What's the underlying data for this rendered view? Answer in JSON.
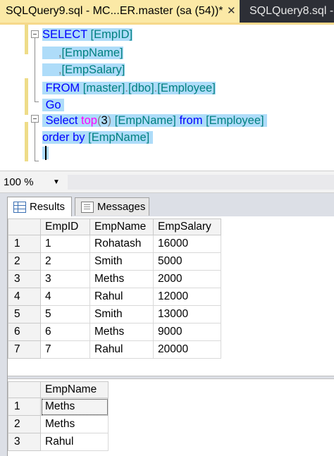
{
  "tabs": {
    "active": {
      "title": "SQLQuery9.sql - MC...ER.master (sa (54))*",
      "close": "✕"
    },
    "inactive": {
      "title": "SQLQuery8.sql -"
    }
  },
  "editor": {
    "line1": {
      "k": "SELECT",
      "c": "[EmpID]"
    },
    "line2": {
      "p": ",",
      "c": "[EmpName]"
    },
    "line3": {
      "p": ",",
      "c": "[EmpSalary]"
    },
    "line4": {
      "k": "FROM",
      "c1": "[master]",
      "c2": "[dbo]",
      "c3": "[Employee]"
    },
    "line5": {
      "k": "Go"
    },
    "line6": {
      "k1": "Select",
      "f": "top",
      "o": "(",
      "n": "3",
      "c": ")",
      "col": "[EmpName]",
      "k2": "from",
      "t": "[Employee]"
    },
    "line7": {
      "k": "order by",
      "c": "[EmpName]"
    }
  },
  "zoom": {
    "value": "100 %"
  },
  "result_tabs": {
    "results": "Results",
    "messages": "Messages"
  },
  "table1": {
    "headers": [
      "EmpID",
      "EmpName",
      "EmpSalary"
    ],
    "rows": [
      [
        "1",
        "1",
        "Rohatash",
        "16000"
      ],
      [
        "2",
        "2",
        "Smith",
        "5000"
      ],
      [
        "3",
        "3",
        "Meths",
        "2000"
      ],
      [
        "4",
        "4",
        "Rahul",
        "12000"
      ],
      [
        "5",
        "5",
        "Smith",
        "13000"
      ],
      [
        "6",
        "6",
        "Meths",
        "9000"
      ],
      [
        "7",
        "7",
        "Rahul",
        "20000"
      ]
    ]
  },
  "table2": {
    "headers": [
      "EmpName"
    ],
    "rows": [
      [
        "1",
        "Meths"
      ],
      [
        "2",
        "Meths"
      ],
      [
        "3",
        "Rahul"
      ]
    ]
  }
}
